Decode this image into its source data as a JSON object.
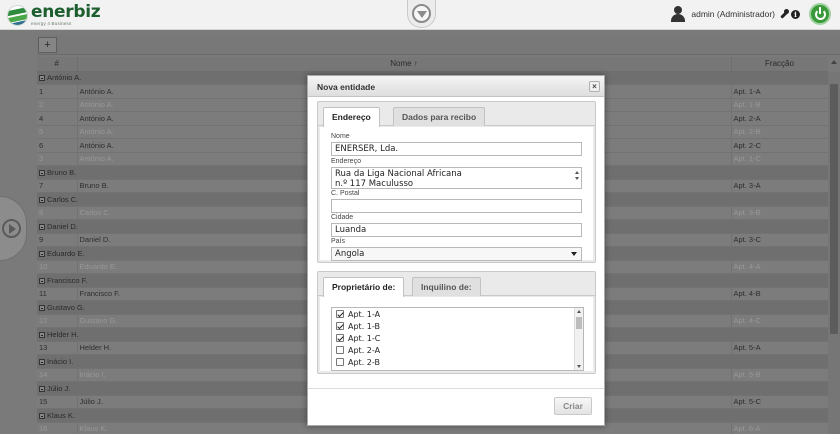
{
  "app": {
    "logo_name": "enerbiz",
    "logo_tagline": "energy 4 Business"
  },
  "user": {
    "name": "admin (Administrador)"
  },
  "toolbar": {
    "add_label": "+"
  },
  "table": {
    "columns": [
      "#",
      "Nome ↑",
      "Fracção"
    ],
    "rows": [
      {
        "type": "group",
        "label": "António A."
      },
      {
        "type": "row",
        "num": "1",
        "name": "António A.",
        "fraccao": "Apt. 1-A",
        "dim": false
      },
      {
        "type": "row",
        "num": "2",
        "name": "António A.",
        "fraccao": "Apt. 1-B",
        "dim": true
      },
      {
        "type": "row",
        "num": "4",
        "name": "António A.",
        "fraccao": "Apt. 2-A",
        "dim": false
      },
      {
        "type": "row",
        "num": "5",
        "name": "António A.",
        "fraccao": "Apt. 2-B",
        "dim": true
      },
      {
        "type": "row",
        "num": "6",
        "name": "António A.",
        "fraccao": "Apt. 2-C",
        "dim": false
      },
      {
        "type": "row",
        "num": "3",
        "name": "António A.",
        "fraccao": "Apt. 1-C",
        "dim": true
      },
      {
        "type": "group",
        "label": "Bruno B."
      },
      {
        "type": "row",
        "num": "7",
        "name": "Bruno B.",
        "fraccao": "Apt. 3-A",
        "dim": false
      },
      {
        "type": "group",
        "label": "Carlos C."
      },
      {
        "type": "row",
        "num": "8",
        "name": "Carlos C.",
        "fraccao": "Apt. 3-B",
        "dim": true
      },
      {
        "type": "group",
        "label": "Daniel D."
      },
      {
        "type": "row",
        "num": "9",
        "name": "Daniel D.",
        "fraccao": "Apt. 3-C",
        "dim": false
      },
      {
        "type": "group",
        "label": "Eduardo E."
      },
      {
        "type": "row",
        "num": "10",
        "name": "Eduardo E.",
        "fraccao": "Apt. 4-A",
        "dim": true
      },
      {
        "type": "group",
        "label": "Francisco F."
      },
      {
        "type": "row",
        "num": "11",
        "name": "Francisco F.",
        "fraccao": "Apt. 4-B",
        "dim": false
      },
      {
        "type": "group",
        "label": "Gustavo G."
      },
      {
        "type": "row",
        "num": "12",
        "name": "Gustavo G.",
        "fraccao": "Apt. 4-C",
        "dim": true
      },
      {
        "type": "group",
        "label": "Helder H."
      },
      {
        "type": "row",
        "num": "13",
        "name": "Helder H.",
        "fraccao": "Apt. 5-A",
        "dim": false
      },
      {
        "type": "group",
        "label": "Inácio I."
      },
      {
        "type": "row",
        "num": "14",
        "name": "Inácio I.",
        "fraccao": "Apt. 5-B",
        "dim": true
      },
      {
        "type": "group",
        "label": "Júlio J."
      },
      {
        "type": "row",
        "num": "15",
        "name": "Júlio J.",
        "fraccao": "Apt. 5-C",
        "dim": false
      },
      {
        "type": "group",
        "label": "Klaus K."
      },
      {
        "type": "row",
        "num": "16",
        "name": "Klaus K.",
        "fraccao": "Apt. 6-A",
        "dim": true
      }
    ]
  },
  "modal": {
    "title": "Nova entidade",
    "tabs": [
      "Endereço",
      "Dados para recibo"
    ],
    "fields": {
      "nome_label": "Nome",
      "nome_value": "ENERSER, Lda.",
      "endereco_label": "Endereço",
      "endereco_line1": "Rua da Liga Nacional Africana",
      "endereco_line2": "n.º 117 Maculusso",
      "cpostal_label": "C. Postal",
      "cpostal_value": "",
      "cidade_label": "Cidade",
      "cidade_value": "Luanda",
      "pais_label": "País",
      "pais_value": "Angola"
    },
    "tabs2": [
      "Proprietário de:",
      "Inquilino de:"
    ],
    "units": [
      {
        "label": "Apt. 1-A",
        "checked": true
      },
      {
        "label": "Apt. 1-B",
        "checked": true
      },
      {
        "label": "Apt. 1-C",
        "checked": true
      },
      {
        "label": "Apt. 2-A",
        "checked": false
      },
      {
        "label": "Apt. 2-B",
        "checked": false
      }
    ],
    "create_label": "Criar",
    "close_label": "×"
  }
}
